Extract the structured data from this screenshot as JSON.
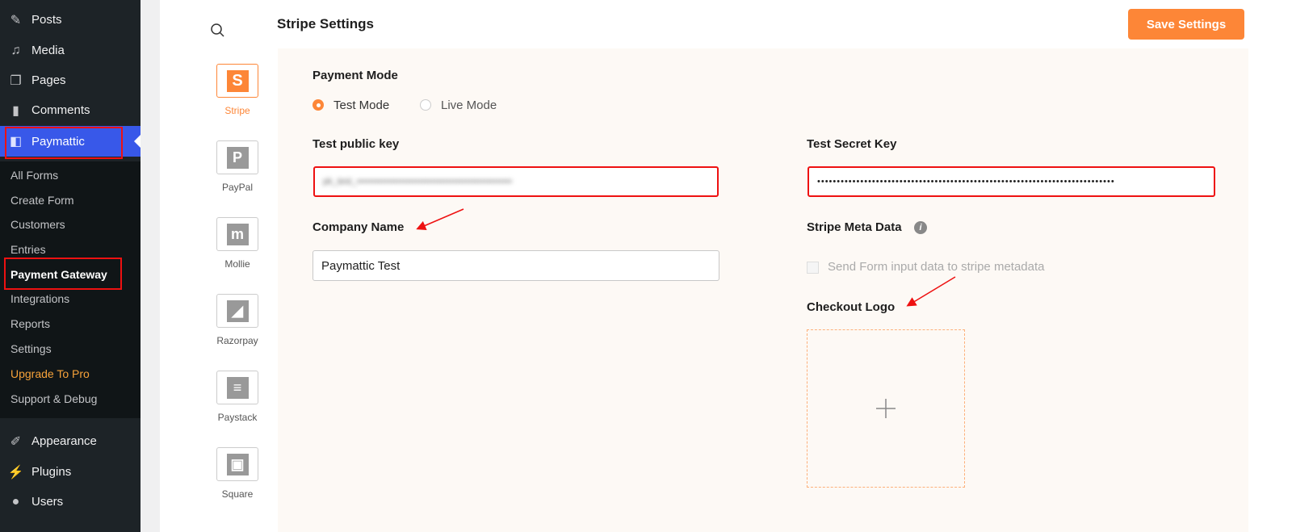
{
  "sidebar": {
    "top": [
      {
        "label": "Posts",
        "icon": "pin-icon"
      },
      {
        "label": "Media",
        "icon": "media-icon"
      },
      {
        "label": "Pages",
        "icon": "pages-icon"
      },
      {
        "label": "Comments",
        "icon": "comment-icon"
      }
    ],
    "active": "Paymattic",
    "sub": [
      "All Forms",
      "Create Form",
      "Customers",
      "Entries",
      "Payment Gateway",
      "Integrations",
      "Reports",
      "Settings",
      "Upgrade To Pro",
      "Support & Debug"
    ],
    "bottom": [
      {
        "label": "Appearance"
      },
      {
        "label": "Plugins"
      },
      {
        "label": "Users"
      }
    ]
  },
  "gateways": [
    {
      "label": "Stripe",
      "glyph": "S"
    },
    {
      "label": "PayPal",
      "glyph": "P"
    },
    {
      "label": "Mollie",
      "glyph": "m"
    },
    {
      "label": "Razorpay",
      "glyph": "◢"
    },
    {
      "label": "Paystack",
      "glyph": "≡"
    },
    {
      "label": "Square",
      "glyph": "▣"
    }
  ],
  "header": {
    "title": "Stripe Settings",
    "save": "Save Settings"
  },
  "form": {
    "payment_mode": "Payment Mode",
    "test_mode": "Test Mode",
    "live_mode": "Live Mode",
    "public_key_label": "Test public key",
    "public_key_value": "pk_test_••••••••••••••••••••••••••••••••••••••••••••••••••",
    "secret_key_label": "Test Secret Key",
    "secret_key_value": "••••••••••••••••••••••••••••••••••••••••••••••••••••••••••••••••••••••••••••",
    "company_label": "Company Name",
    "company_value": "Paymattic Test",
    "meta_label": "Stripe Meta Data",
    "meta_checkbox": "Send Form input data to stripe metadata",
    "logo_label": "Checkout Logo"
  },
  "colors": {
    "accent": "#fd8637",
    "wp_active": "#3858e9"
  }
}
